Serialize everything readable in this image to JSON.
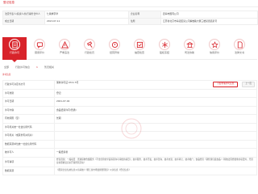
{
  "header": {
    "title": "登记信息"
  },
  "info": {
    "rows": [
      {
        "l1": "法定代表人/投资人/执行事务合伙人",
        "v1": "仁湖求宇律",
        "l2": "企业名称",
        "v2": "四海市国有公司"
      },
      {
        "l1": "成立日期",
        "v1": "2013-07-11",
        "l2": "住所",
        "v2": "江苏省北京市海淀区某公司解放路大厦三楼某街道某号"
      }
    ]
  },
  "tabs": [
    {
      "label": "行政许可",
      "icon": "permit-icon",
      "active": true
    },
    {
      "label": "错误评价",
      "icon": "comment-icon",
      "active": false
    },
    {
      "label": "严重违法",
      "icon": "warning-icon",
      "active": false
    },
    {
      "label": "行政处罚",
      "icon": "gavel-icon",
      "active": false
    },
    {
      "label": "经营异常",
      "icon": "alert-icon",
      "active": false
    },
    {
      "label": "抽查检查",
      "icon": "check-icon",
      "active": false
    },
    {
      "label": "股权冻结",
      "icon": "freeze-icon",
      "active": false
    },
    {
      "label": "司法协助",
      "icon": "court-icon",
      "active": false
    },
    {
      "label": "信用评价",
      "icon": "rating-icon",
      "active": false
    },
    {
      "label": "法律文书",
      "icon": "document-icon",
      "active": false
    }
  ],
  "filter": {
    "label1": "全部",
    "label2": "行政许可信息",
    "chip": "1",
    "label3": "暂无相关"
  },
  "section": {
    "title": "许可信息"
  },
  "detail": {
    "rows": [
      {
        "label": "行政许可决定书文号",
        "value": "浙杭许可证 0721 5号",
        "doc_btn": "下载/查看许可证照",
        "prev_btn": "上一页"
      },
      {
        "label": "许可类别",
        "value": "登记"
      },
      {
        "label": "许可日期",
        "value": "2021-07-04"
      },
      {
        "label": "许可内容",
        "value": "食品经营许可(普通)"
      },
      {
        "label": "有效期限（至）",
        "value": "长期"
      },
      {
        "label": "许可机关统一社会信用代码",
        "value": ""
      },
      {
        "label": "许可机关（或其他有关机关）",
        "value": ""
      },
      {
        "label": "数据来源单位统一社会信用代码",
        "value": ""
      },
      {
        "label": "被许可人",
        "value": "一般经营者"
      },
      {
        "label": "许可事项",
        "value": "经营范围：一般项目：普通货物仓储服务（不含危险化学品等需许可审批的项目）；技术服务、技术开发、技术咨询、技术交流、技术转让、技术推广；食品经营（销售预包装食品）（除依法须经批准的项目外，凭营业执照依法自主开展经营活动）"
      },
      {
        "label": "数据来源",
        "value": "《国家企业信用信息公示系统》《浙江省市场监督管理局》公示信息《登记信息》"
      }
    ]
  },
  "colors": {
    "accent": "#d8232a"
  }
}
